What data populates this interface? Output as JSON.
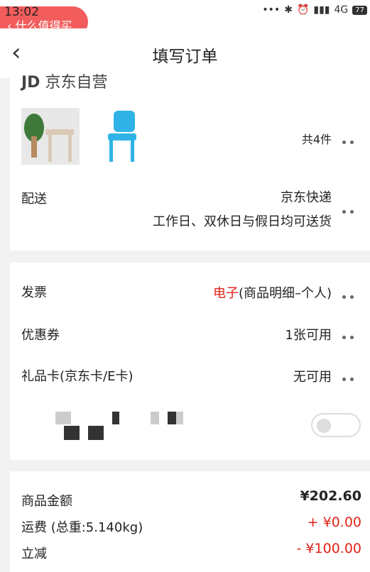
{
  "status": {
    "time": "13:02",
    "signal": "4G",
    "battery": "77"
  },
  "back_pill": {
    "label": "什么值得买"
  },
  "nav": {
    "title": "填写订单"
  },
  "shop": {
    "name": "京东自营",
    "item_count": "共4件"
  },
  "delivery": {
    "label": "配送",
    "method": "京东快递",
    "schedule": "工作日、双休日与假日均可送货"
  },
  "invoice": {
    "label": "发票",
    "type": "电子",
    "detail": "(商品明细–个人)"
  },
  "coupon": {
    "label": "优惠券",
    "value": "1张可用"
  },
  "giftcard": {
    "label": "礼品卡(京东卡/E卡)",
    "value": "无可用"
  },
  "summary": {
    "goods_label": "商品金额",
    "goods_value": "¥202.60",
    "shipping_label": "运费 (总重:5.140kg)",
    "shipping_value": "+ ¥0.00",
    "discount_label": "立减",
    "discount_value": "- ¥100.00"
  },
  "colors": {
    "accent": "#e2231a",
    "pill": "#f25c5c"
  },
  "icons": [
    "back-chevron-icon",
    "more-dots-icon",
    "toggle-switch"
  ]
}
